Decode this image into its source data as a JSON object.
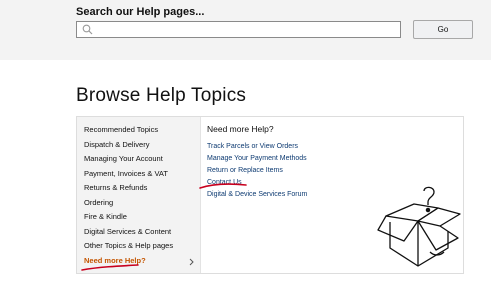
{
  "search": {
    "title": "Search our Help pages...",
    "placeholder": "",
    "go_label": "Go"
  },
  "page": {
    "heading": "Browse Help Topics"
  },
  "sidebar": {
    "items": [
      {
        "label": "Recommended Topics"
      },
      {
        "label": "Dispatch & Delivery"
      },
      {
        "label": "Managing Your Account"
      },
      {
        "label": "Payment, Invoices & VAT"
      },
      {
        "label": "Returns & Refunds"
      },
      {
        "label": "Ordering"
      },
      {
        "label": "Fire & Kindle"
      },
      {
        "label": "Digital Services & Content"
      },
      {
        "label": "Other Topics & Help pages"
      },
      {
        "label": "Need more Help?"
      }
    ],
    "active_index": 9
  },
  "content": {
    "title": "Need more Help?",
    "links": [
      {
        "label": "Track Parcels or View Orders"
      },
      {
        "label": "Manage Your Payment Methods"
      },
      {
        "label": "Return or Replace Items"
      },
      {
        "label": "Contact Us"
      },
      {
        "label": "Digital & Device Services Forum"
      }
    ]
  },
  "icons": [
    "search-icon",
    "chevron-right-icon",
    "question-box-icon"
  ],
  "colors": {
    "active_item": "#c45500",
    "link": "#0e3b72",
    "annotation": "#c8001e"
  }
}
